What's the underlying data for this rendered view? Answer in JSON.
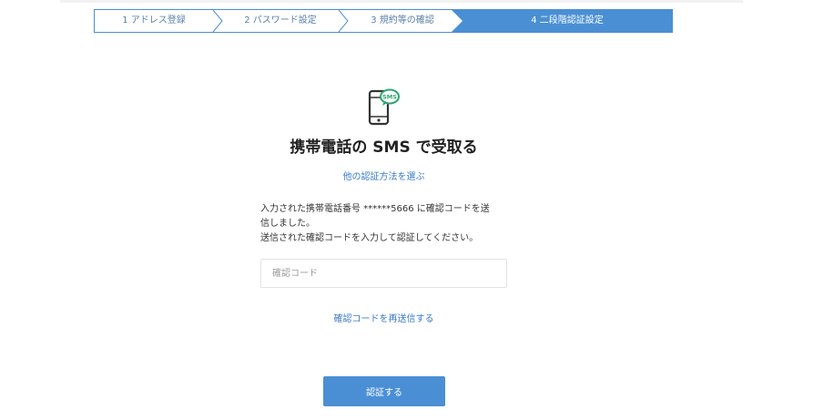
{
  "steps": [
    {
      "label": "1 アドレス登録",
      "state": "done"
    },
    {
      "label": "2 パスワード設定",
      "state": "done"
    },
    {
      "label": "3 規約等の確認",
      "state": "done"
    },
    {
      "label": "4 二段階認証設定",
      "state": "active"
    }
  ],
  "icon": {
    "name": "phone-sms-icon",
    "badge_text": "SMS"
  },
  "title": "携帯電話の SMS で受取る",
  "other_method_link": "他の認証方法を選ぶ",
  "message": {
    "line1": "入力された携帯電話番号 ******5666 に確認コードを送",
    "line2": "信しました。",
    "line3": "送信された確認コードを入力して認証してください。"
  },
  "code_input": {
    "placeholder": "確認コード",
    "value": ""
  },
  "resend_link": "確認コードを再送信する",
  "verify_button": "認証する",
  "colors": {
    "accent": "#4a8fd4",
    "link": "#3a7bc8",
    "sms_badge": "#2ba66b"
  }
}
